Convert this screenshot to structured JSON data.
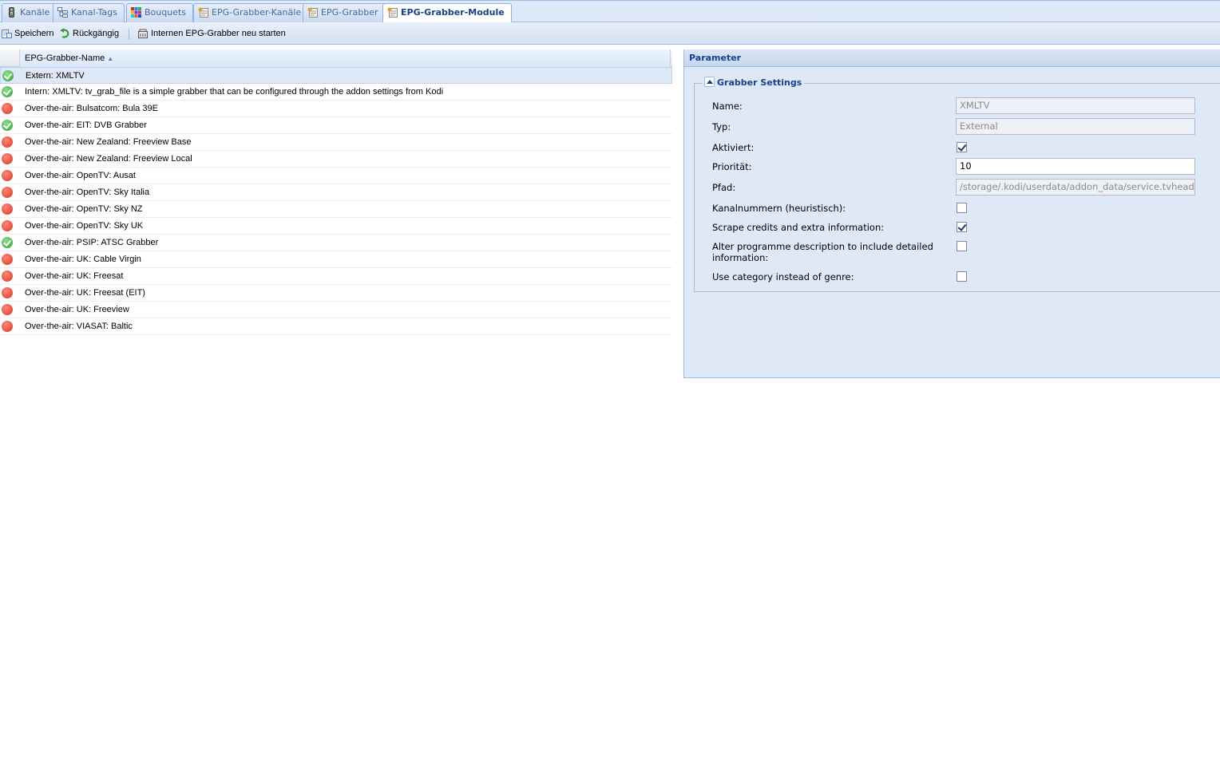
{
  "tabs": [
    {
      "label": "Kanäle",
      "icon": "remote-icon"
    },
    {
      "label": "Kanal-Tags",
      "icon": "tag-tree-icon"
    },
    {
      "label": "Bouquets",
      "icon": "grid-colors-icon"
    },
    {
      "label": "EPG-Grabber-Kanäle",
      "icon": "list-check-icon"
    },
    {
      "label": "EPG-Grabber",
      "icon": "list-check-icon"
    },
    {
      "label": "EPG-Grabber-Module",
      "icon": "list-check-icon",
      "active": true
    }
  ],
  "toolbar": {
    "save_label": "Speichern",
    "undo_label": "Rückgängig",
    "restart_label": "Internen EPG-Grabber neu starten"
  },
  "grid": {
    "column_header": "EPG-Grabber-Name",
    "rows": [
      {
        "name": "Extern: XMLTV",
        "enabled": true,
        "selected": true
      },
      {
        "name": "Intern: XMLTV: tv_grab_file is a simple grabber that can be configured through the addon settings from Kodi",
        "enabled": true
      },
      {
        "name": "Over-the-air: Bulsatcom: Bula 39E",
        "enabled": false
      },
      {
        "name": "Over-the-air: EIT: DVB Grabber",
        "enabled": true
      },
      {
        "name": "Over-the-air: New Zealand: Freeview Base",
        "enabled": false
      },
      {
        "name": "Over-the-air: New Zealand: Freeview Local",
        "enabled": false
      },
      {
        "name": "Over-the-air: OpenTV: Ausat",
        "enabled": false
      },
      {
        "name": "Over-the-air: OpenTV: Sky Italia",
        "enabled": false
      },
      {
        "name": "Over-the-air: OpenTV: Sky NZ",
        "enabled": false
      },
      {
        "name": "Over-the-air: OpenTV: Sky UK",
        "enabled": false
      },
      {
        "name": "Over-the-air: PSIP: ATSC Grabber",
        "enabled": true
      },
      {
        "name": "Over-the-air: UK: Cable Virgin",
        "enabled": false
      },
      {
        "name": "Over-the-air: UK: Freesat",
        "enabled": false
      },
      {
        "name": "Over-the-air: UK: Freesat (EIT)",
        "enabled": false
      },
      {
        "name": "Over-the-air: UK: Freeview",
        "enabled": false
      },
      {
        "name": "Over-the-air: VIASAT: Baltic",
        "enabled": false
      }
    ]
  },
  "param": {
    "title": "Parameter",
    "fieldset_title": "Grabber Settings",
    "name_label": "Name:",
    "name_value": "XMLTV",
    "type_label": "Typ:",
    "type_value": "External",
    "enabled_label": "Aktiviert:",
    "enabled_value": true,
    "priority_label": "Priorität:",
    "priority_value": "10",
    "path_label": "Pfad:",
    "path_value": "/storage/.kodi/userdata/addon_data/service.tvheadend",
    "channel_numbers_label": "Kanalnummern (heuristisch):",
    "channel_numbers_value": false,
    "scrape_label": "Scrape credits and extra information:",
    "scrape_value": true,
    "alter_desc_label": "Alter programme description to include detailed information:",
    "alter_desc_value": false,
    "category_label": "Use category instead of genre:",
    "category_value": false
  },
  "colors": {
    "accent": "#15428b",
    "panel_bg": "#dfe8f6",
    "border": "#99bbe8",
    "ok_green": "#2e9c2e",
    "off_red": "#d9331f"
  }
}
